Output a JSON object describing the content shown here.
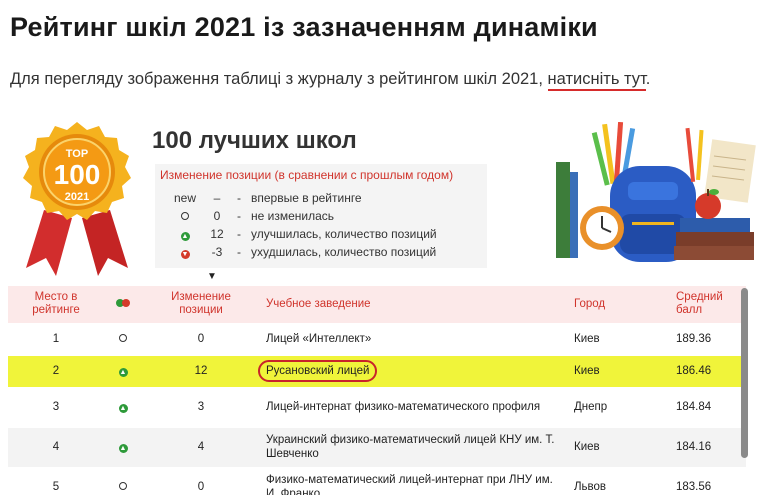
{
  "header": {
    "title": "Рейтинг шкіл 2021 із зазначенням динаміки",
    "intro_text": "Для перегляду зображення таблиці з журналу з рейтингом шкіл 2021, ",
    "intro_link": "натисніть тут",
    "intro_end": "."
  },
  "medal": {
    "top": "TOP",
    "number": "100",
    "year": "2021"
  },
  "infographic": {
    "heading": "100 лучших школ",
    "legend_title": "Изменение позиции (в сравнении с прошлым годом)",
    "legend": [
      {
        "symbol": "new",
        "value": "–",
        "text": "впервые в рейтинге"
      },
      {
        "symbol": "circle",
        "value": "0",
        "text": "не изменилась"
      },
      {
        "symbol": "up",
        "value": "12",
        "text": "улучшилась, количество позиций"
      },
      {
        "symbol": "down",
        "value": "-3",
        "text": "ухудшилась, количество позиций"
      }
    ]
  },
  "table": {
    "headers": {
      "rank": "Место в рейтинге",
      "change": "Изменение позиции",
      "school": "Учебное заведение",
      "city": "Город",
      "score": "Средний балл"
    },
    "rows": [
      {
        "rank": "1",
        "icon": "circle",
        "change": "0",
        "school": "Лицей «Интеллект»",
        "city": "Киев",
        "score": "189.36"
      },
      {
        "rank": "2",
        "icon": "up",
        "change": "12",
        "school": "Русановский лицей",
        "city": "Киев",
        "score": "186.46"
      },
      {
        "rank": "3",
        "icon": "up",
        "change": "3",
        "school": "Лицей-интернат физико-математического профиля",
        "city": "Днепр",
        "score": "184.84"
      },
      {
        "rank": "4",
        "icon": "up",
        "change": "4",
        "school": "Украинский физико-математический лицей КНУ им. Т. Шевченко",
        "city": "Киев",
        "score": "184.16"
      },
      {
        "rank": "5",
        "icon": "circle",
        "change": "0",
        "school": "Физико-математический лицей-интернат при ЛНУ им. И. Франко",
        "city": "Львов",
        "score": "183.56"
      }
    ]
  }
}
